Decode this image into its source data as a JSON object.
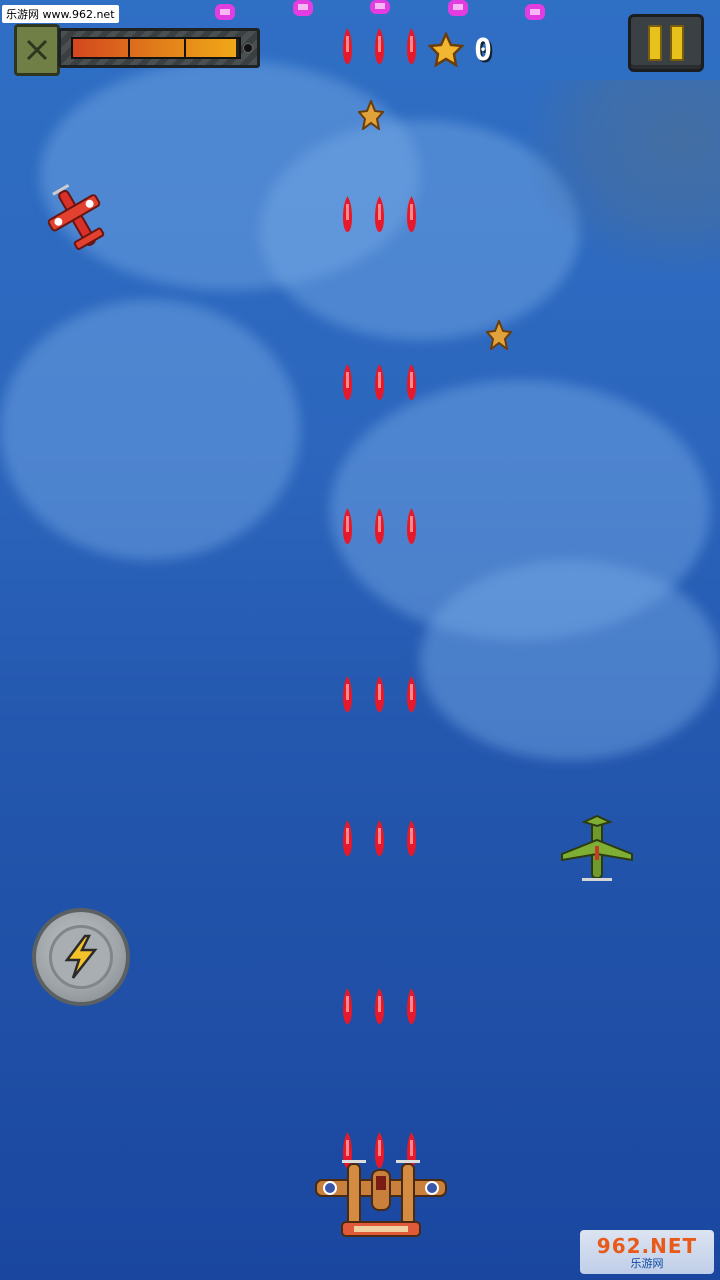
{
  "watermark_top": "乐游网 www.962.net",
  "watermark_bottom": {
    "logo": "962.NET",
    "sub": "乐游网"
  },
  "hud": {
    "fuel_level": 0.98,
    "score": "0"
  },
  "colors": {
    "bullet": "#e8182b",
    "enemy_shot": "#e23de0",
    "accent_yellow": "#e8c21c"
  },
  "icons": {
    "fuel": "fuel-can-icon",
    "score": "star-icon",
    "pause": "pause-icon",
    "bomb": "lightning-bolt-icon"
  }
}
